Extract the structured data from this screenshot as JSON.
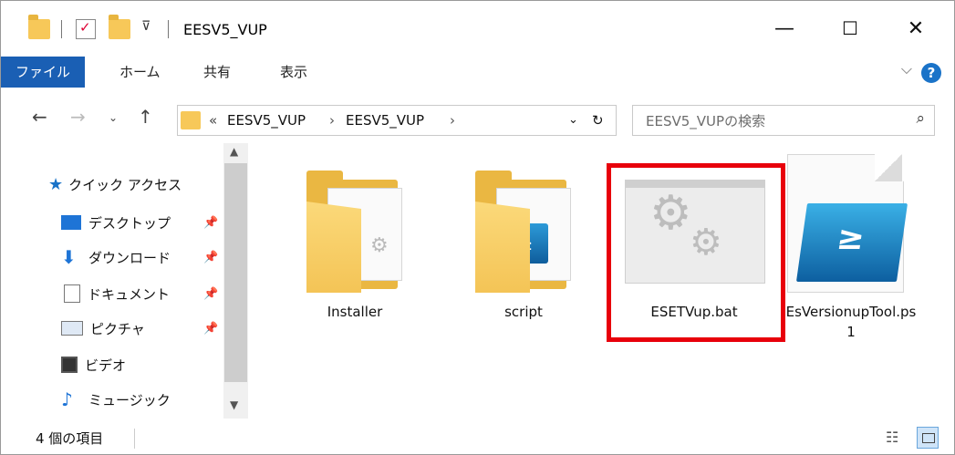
{
  "window": {
    "title": "EESV5_VUP",
    "minimize": "—",
    "maximize": "☐",
    "close": "✕"
  },
  "ribbon": {
    "tabs": [
      "ファイル",
      "ホーム",
      "共有",
      "表示"
    ],
    "help": "?"
  },
  "navigation": {
    "breadcrumb_overflow": "«",
    "breadcrumb": [
      "EESV5_VUP",
      "EESV5_VUP"
    ],
    "search_placeholder": "EESV5_VUPの検索"
  },
  "sidebar": {
    "quick_access": "クイック アクセス",
    "items": [
      {
        "label": "デスクトップ",
        "icon": "desktop-icon",
        "pinned": true
      },
      {
        "label": "ダウンロード",
        "icon": "download-icon",
        "pinned": true
      },
      {
        "label": "ドキュメント",
        "icon": "document-icon",
        "pinned": true
      },
      {
        "label": "ピクチャ",
        "icon": "picture-icon",
        "pinned": true
      },
      {
        "label": "ビデオ",
        "icon": "video-icon",
        "pinned": false
      },
      {
        "label": "ミュージック",
        "icon": "music-icon",
        "pinned": false
      }
    ]
  },
  "files": [
    {
      "name": "Installer",
      "type": "folder"
    },
    {
      "name": "script",
      "type": "folder"
    },
    {
      "name": "ESETVup.bat",
      "type": "batch",
      "highlighted": true
    },
    {
      "name": "EsVersionupTool.ps1",
      "type": "powershell"
    }
  ],
  "status": {
    "item_count": "4 個の項目"
  },
  "colors": {
    "accent": "#1a5fb4",
    "highlight": "#e8000b",
    "folder": "#f4c456"
  }
}
